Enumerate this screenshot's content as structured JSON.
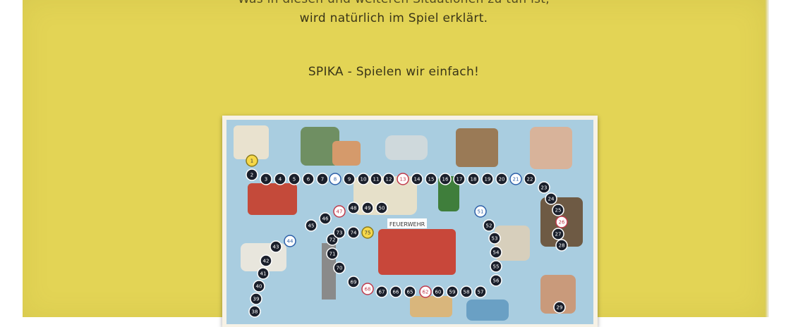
{
  "text": {
    "line_cut": "Was in diesen und weiteren Situationen zu tun ist,",
    "line_1": "wird natürlich im Spiel erklärt.",
    "line_2": "SPIKA - Spielen wir einfach!"
  },
  "colors": {
    "background": "#e3d455",
    "text": "#3a3518",
    "board_sky": "#a9cde0",
    "token": "#1a1f2b"
  },
  "board": {
    "title": "Board game illustration",
    "badge": "FEUERWEHR",
    "spaces": [
      {
        "n": "1",
        "style": "yellow"
      },
      {
        "n": "2",
        "style": "dark"
      },
      {
        "n": "3",
        "style": "dark"
      },
      {
        "n": "4",
        "style": "dark"
      },
      {
        "n": "5",
        "style": "dark"
      },
      {
        "n": "6",
        "style": "dark"
      },
      {
        "n": "7",
        "style": "dark"
      },
      {
        "n": "8",
        "style": "ring-blue"
      },
      {
        "n": "9",
        "style": "dark"
      },
      {
        "n": "10",
        "style": "dark"
      },
      {
        "n": "11",
        "style": "dark"
      },
      {
        "n": "12",
        "style": "dark"
      },
      {
        "n": "13",
        "style": "ring-red"
      },
      {
        "n": "14",
        "style": "dark"
      },
      {
        "n": "15",
        "style": "dark"
      },
      {
        "n": "16",
        "style": "dark"
      },
      {
        "n": "17",
        "style": "dark"
      },
      {
        "n": "18",
        "style": "dark"
      },
      {
        "n": "19",
        "style": "dark"
      },
      {
        "n": "20",
        "style": "dark"
      },
      {
        "n": "21",
        "style": "ring-blue"
      },
      {
        "n": "22",
        "style": "dark"
      },
      {
        "n": "23",
        "style": "dark"
      },
      {
        "n": "24",
        "style": "dark"
      },
      {
        "n": "25",
        "style": "dark"
      },
      {
        "n": "26",
        "style": "ring-red"
      },
      {
        "n": "27",
        "style": "dark"
      },
      {
        "n": "28",
        "style": "dark"
      },
      {
        "n": "29",
        "style": "dark"
      },
      {
        "n": "38",
        "style": "dark"
      },
      {
        "n": "39",
        "style": "dark"
      },
      {
        "n": "40",
        "style": "dark"
      },
      {
        "n": "41",
        "style": "dark"
      },
      {
        "n": "42",
        "style": "dark"
      },
      {
        "n": "43",
        "style": "dark"
      },
      {
        "n": "44",
        "style": "ring-blue"
      },
      {
        "n": "45",
        "style": "dark"
      },
      {
        "n": "46",
        "style": "dark"
      },
      {
        "n": "47",
        "style": "ring-red"
      },
      {
        "n": "48",
        "style": "dark"
      },
      {
        "n": "49",
        "style": "dark"
      },
      {
        "n": "50",
        "style": "dark"
      },
      {
        "n": "51",
        "style": "ring-blue"
      },
      {
        "n": "52",
        "style": "dark"
      },
      {
        "n": "53",
        "style": "dark"
      },
      {
        "n": "54",
        "style": "dark"
      },
      {
        "n": "55",
        "style": "dark"
      },
      {
        "n": "56",
        "style": "dark"
      },
      {
        "n": "57",
        "style": "dark"
      },
      {
        "n": "58",
        "style": "dark"
      },
      {
        "n": "59",
        "style": "dark"
      },
      {
        "n": "60",
        "style": "dark"
      },
      {
        "n": "62",
        "style": "ring-red"
      },
      {
        "n": "65",
        "style": "dark"
      },
      {
        "n": "66",
        "style": "dark"
      },
      {
        "n": "67",
        "style": "dark"
      },
      {
        "n": "68",
        "style": "ring-red"
      },
      {
        "n": "69",
        "style": "dark"
      },
      {
        "n": "70",
        "style": "dark"
      },
      {
        "n": "71",
        "style": "dark"
      },
      {
        "n": "72",
        "style": "dark"
      },
      {
        "n": "73",
        "style": "dark"
      },
      {
        "n": "74",
        "style": "dark"
      },
      {
        "n": "75",
        "style": "yellow"
      }
    ]
  }
}
